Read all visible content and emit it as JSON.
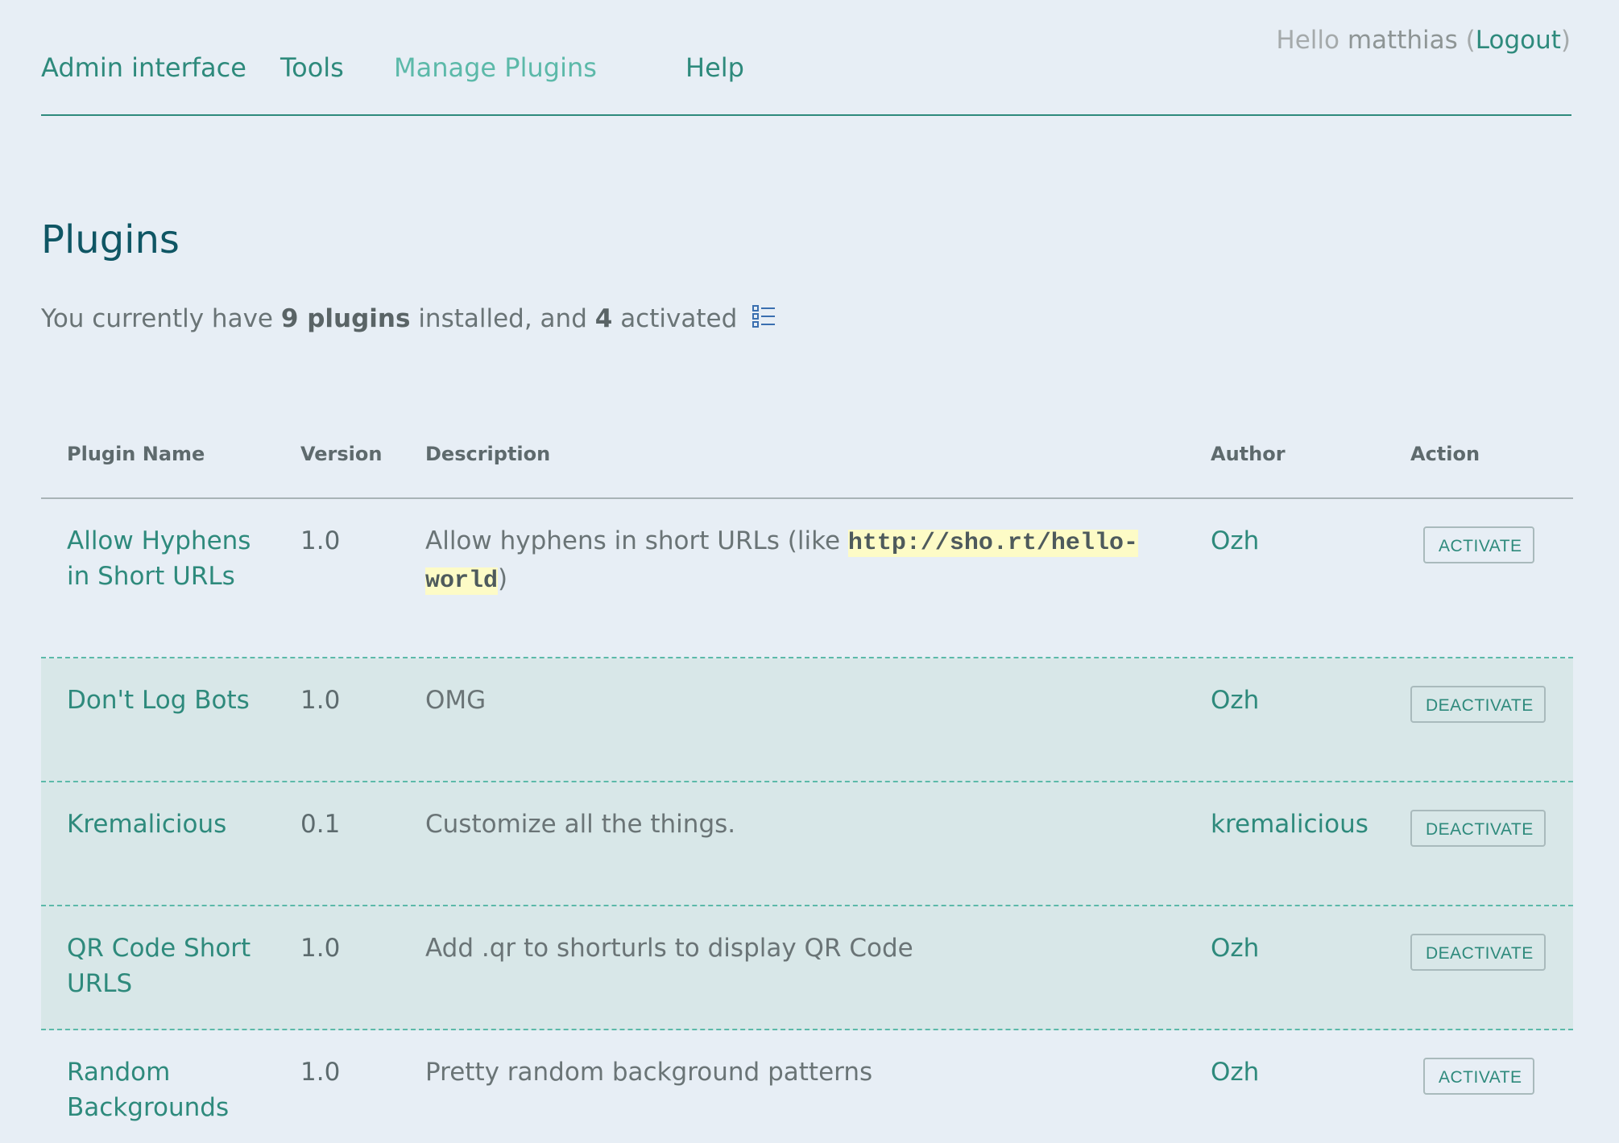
{
  "nav": {
    "items": [
      {
        "label": "Admin interface",
        "active": false
      },
      {
        "label": "Tools",
        "active": false
      },
      {
        "label": "Manage Plugins",
        "active": true
      },
      {
        "label": "Help",
        "active": false
      }
    ],
    "greeting_prefix": "Hello",
    "username": "matthias",
    "logout_label": "Logout"
  },
  "page": {
    "title": "Plugins",
    "summary_prefix": "You currently have",
    "installed_count": "9 plugins",
    "summary_middle": "installed, and",
    "activated_count": "4",
    "summary_suffix": "activated",
    "list_icon": "list-icon"
  },
  "table": {
    "headers": {
      "name": "Plugin Name",
      "version": "Version",
      "description": "Description",
      "author": "Author",
      "action": "Action"
    },
    "rows": [
      {
        "name": "Allow Hyphens in Short URLs",
        "version": "1.0",
        "description_prefix": "Allow hyphens in short URLs (like ",
        "description_code": "http://sho.rt/hello-world",
        "description_suffix": ")",
        "author": "Ozh",
        "action": "Activate",
        "active": false
      },
      {
        "name": "Don't Log Bots",
        "version": "1.0",
        "description": "OMG",
        "author": "Ozh",
        "action": "Deactivate",
        "active": true
      },
      {
        "name": "Kremalicious",
        "version": "0.1",
        "description": "Customize all the things.",
        "author": "kremalicious",
        "action": "Deactivate",
        "active": true
      },
      {
        "name": "QR Code Short URLS",
        "version": "1.0",
        "description": "Add .qr to shorturls to display QR Code",
        "author": "Ozh",
        "action": "Deactivate",
        "active": true
      },
      {
        "name": "Random Backgrounds",
        "version": "1.0",
        "description": "Pretty random background patterns",
        "author": "Ozh",
        "action": "Activate",
        "active": false
      }
    ]
  },
  "colors": {
    "background": "#e7eef5",
    "accent": "#2e8a7c",
    "accent_light": "#5cb9a9",
    "title": "#0f5664",
    "active_row": "#d8e7e8",
    "code_highlight": "#fdfbc6"
  }
}
